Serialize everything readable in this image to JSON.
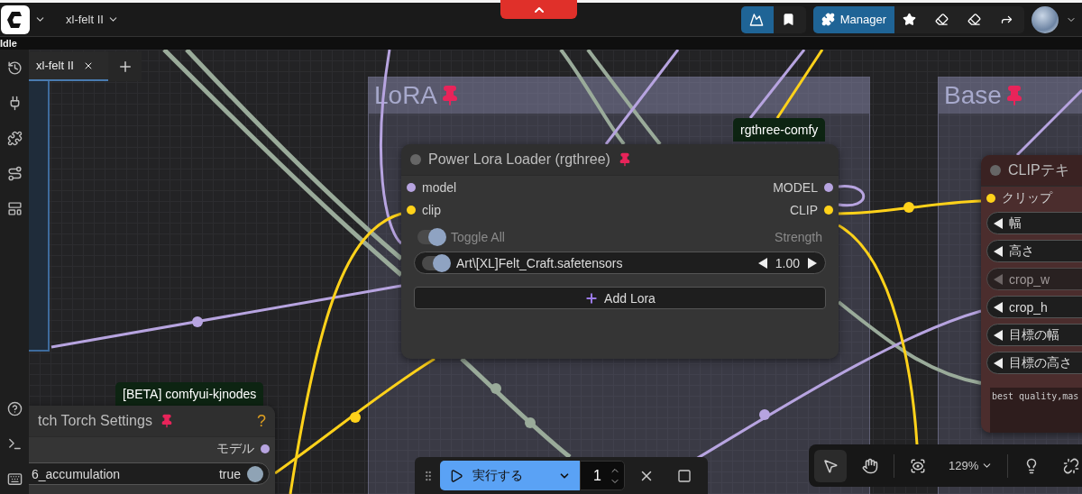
{
  "topbar": {
    "workflow": "xl-felt II",
    "manager_label": "Manager",
    "status": "Idle"
  },
  "tabs": [
    {
      "label": "xl-felt II",
      "selected": true
    }
  ],
  "groups": [
    {
      "title": "LoRA",
      "pinned": true
    },
    {
      "title": "Base",
      "pinned": true
    }
  ],
  "lora_node": {
    "source": "rgthree-comfy",
    "title": "Power Lora Loader (rgthree)",
    "pinned": true,
    "inputs": [
      {
        "label": "model",
        "color": "#b7a4e0"
      },
      {
        "label": "clip",
        "color": "#ffd21a"
      }
    ],
    "outputs": [
      {
        "label": "MODEL",
        "color": "#b7a4e0"
      },
      {
        "label": "CLIP",
        "color": "#ffd21a"
      }
    ],
    "toggle_all": {
      "label": "Toggle All",
      "on": true
    },
    "strength_label": "Strength",
    "loras": [
      {
        "name": "Art\\[XL]Felt_Craft.safetensors",
        "on": true,
        "strength": "1.00"
      }
    ],
    "add_label": "Add Lora"
  },
  "torch_node": {
    "source": "[BETA] comfyui-kjnodes",
    "title": "tch Torch Settings",
    "pinned": true,
    "help": "?",
    "outputs": [
      {
        "label": "モデル",
        "color": "#b7a4e0"
      }
    ],
    "widgets": [
      {
        "label": "6_accumulation",
        "value": "true",
        "on": true
      }
    ]
  },
  "clip_node": {
    "title": "CLIPテキ",
    "inputs": [
      {
        "label": "クリップ",
        "color": "#ffd21a"
      }
    ],
    "widgets": [
      {
        "label": "幅",
        "disabled": false
      },
      {
        "label": "高さ",
        "disabled": false
      },
      {
        "label": "crop_w",
        "disabled": true
      },
      {
        "label": "crop_h",
        "disabled": false
      },
      {
        "label": "目標の幅",
        "disabled": false
      },
      {
        "label": "目標の高さ",
        "disabled": false
      }
    ],
    "text": "best quality,mas"
  },
  "run_toolbar": {
    "run_label": "実行する",
    "count": "1"
  },
  "canvas_toolbar": {
    "zoom": "129%"
  }
}
